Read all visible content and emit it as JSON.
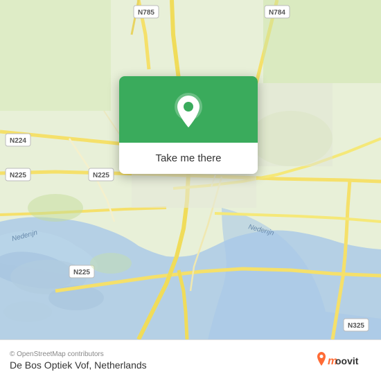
{
  "map": {
    "copyright": "© OpenStreetMap contributors",
    "background_color": "#e8f0d8"
  },
  "popup": {
    "button_label": "Take me there",
    "header_color": "#3aab5c"
  },
  "bottom_bar": {
    "copyright": "© OpenStreetMap contributors",
    "location_name": "De Bos Optiek Vof, Netherlands",
    "logo_text": "moovit"
  }
}
